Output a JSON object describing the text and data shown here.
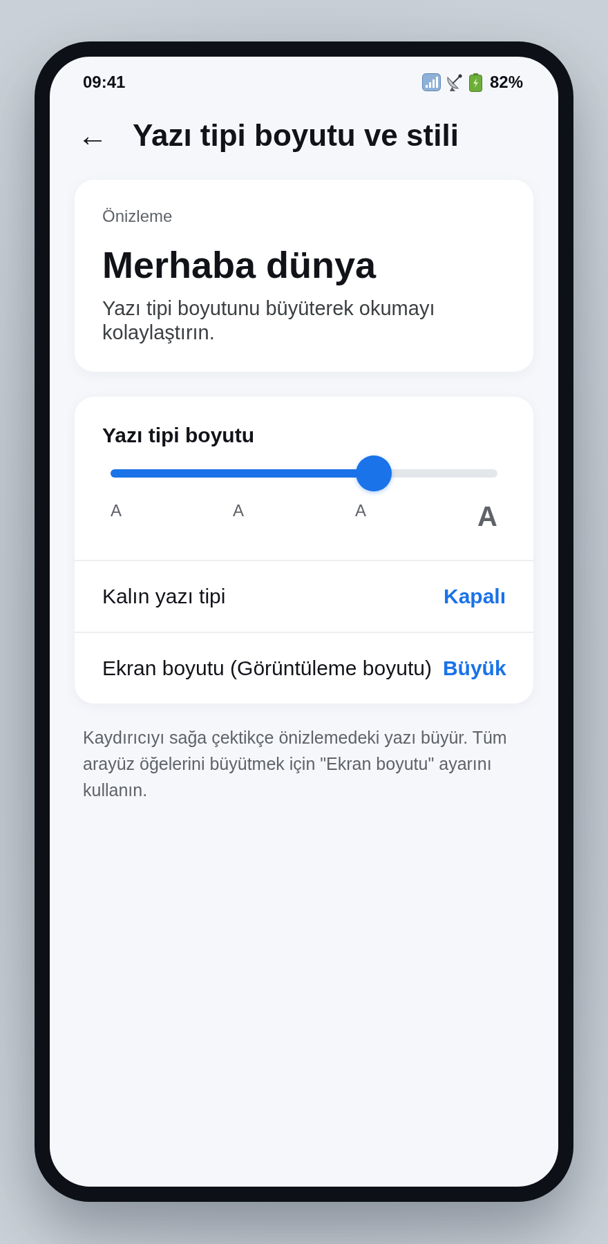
{
  "status_bar": {
    "time": "09:41",
    "battery": "82%"
  },
  "header": {
    "back": "←",
    "title": "Yazı tipi boyutu ve stili"
  },
  "preview": {
    "label": "Önizleme",
    "heading": "Merhaba dünya",
    "text": "Yazı tipi boyutunu büyüterek okumayı kolaylaştırın."
  },
  "font_size": {
    "title": "Yazı tipi boyutu",
    "level": 0.68,
    "markers": [
      {
        "text": "A",
        "kind": "small"
      },
      {
        "text": "A",
        "kind": "small"
      },
      {
        "text": "A",
        "kind": "small"
      },
      {
        "text": "A",
        "kind": "large"
      }
    ]
  },
  "settings": [
    {
      "label": "Kalın yazı tipi",
      "value": "Kapalı"
    },
    {
      "label": "Ekran boyutu (Görüntüleme boyutu)",
      "value": "Büyük"
    }
  ],
  "note": "Kaydırıcıyı sağa çektikçe önizlemedeki yazı büyür. Tüm arayüz öğelerini büyütmek için \"Ekran boyutu\" ayarını kullanın."
}
